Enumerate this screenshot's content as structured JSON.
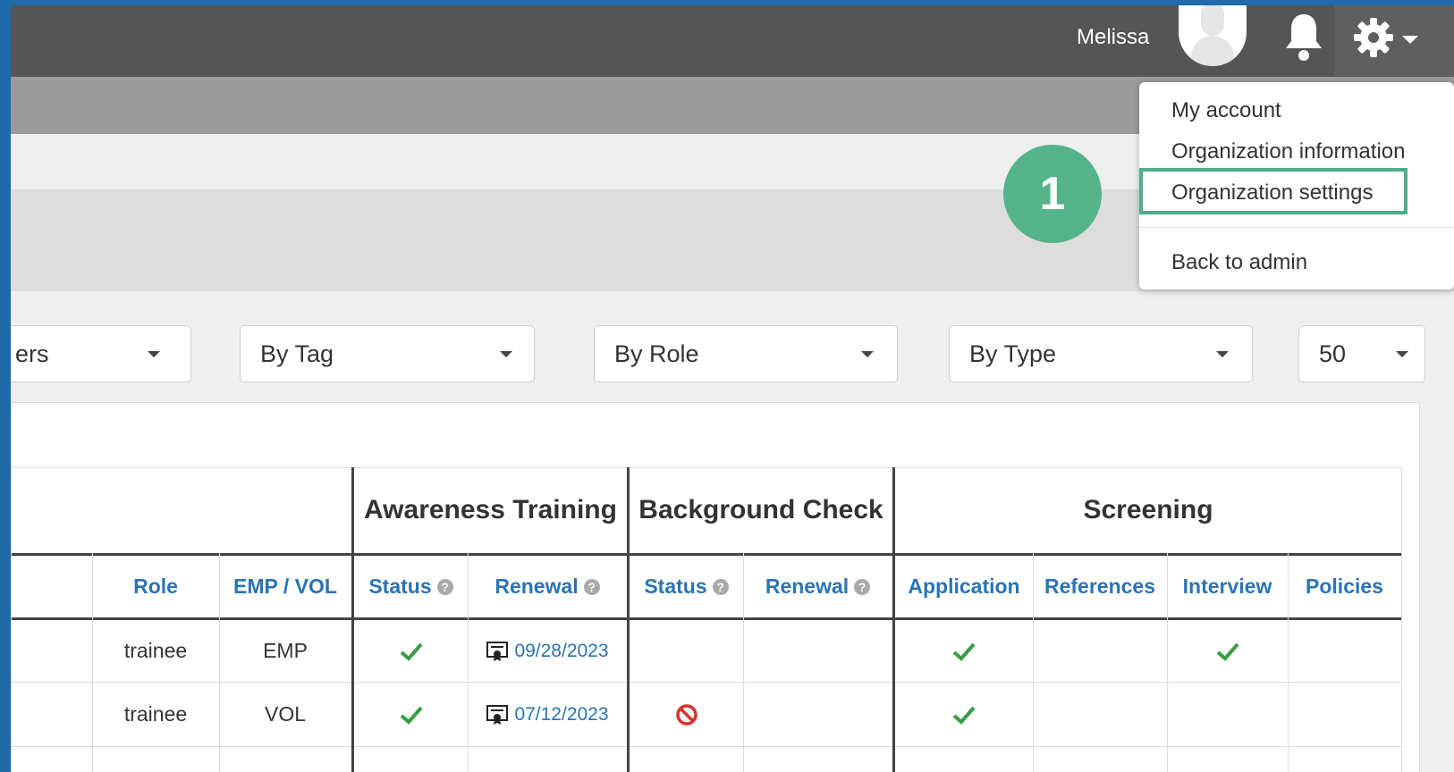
{
  "topbar": {
    "user_name": "Melissa",
    "avatar_icon": "avatar-icon",
    "bell_icon": "bell-icon",
    "gear_icon": "gear-icon"
  },
  "menu": {
    "items": [
      "My account",
      "Organization information",
      "Organization settings",
      "Back to admin"
    ]
  },
  "annotation": {
    "step_number": "1",
    "highlight_color": "#4fae85",
    "badge_color": "#55b38a"
  },
  "filters": {
    "first_partial": "ers",
    "tag": "By Tag",
    "role": "By Role",
    "type": "By Type",
    "per_page": "50"
  },
  "table": {
    "groups": {
      "awareness": "Awareness Training",
      "background": "Background Check",
      "screening": "Screening"
    },
    "headers": {
      "role": "Role",
      "emp_vol": "EMP / VOL",
      "at_status": "Status",
      "at_renewal": "Renewal",
      "bc_status": "Status",
      "bc_renewal": "Renewal",
      "application": "Application",
      "references": "References",
      "interview": "Interview",
      "policies": "Policies"
    },
    "rows": [
      {
        "role": "trainee",
        "emp_vol": "EMP",
        "at_renewal": "09/28/2023"
      },
      {
        "role": "trainee",
        "emp_vol": "VOL",
        "at_renewal": "07/12/2023"
      }
    ]
  },
  "colors": {
    "accent_blue": "#2a74b5",
    "check_green": "#3a9d45",
    "deny_red": "#d9312b",
    "brand_frame": "#1f6aa8"
  }
}
